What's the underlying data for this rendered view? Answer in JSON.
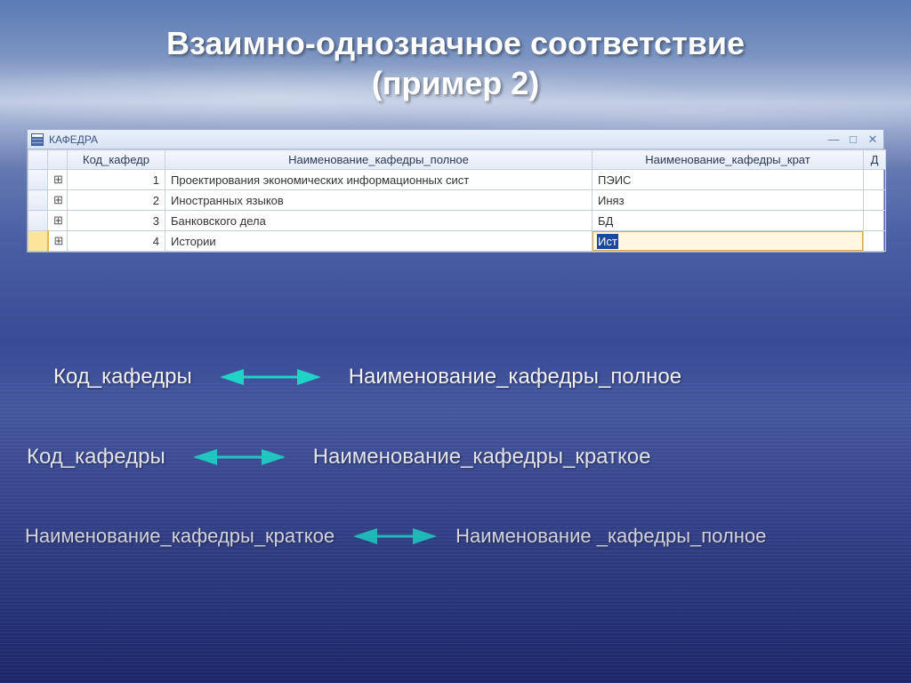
{
  "slide": {
    "title_line1": "Взаимно-однозначное  соответствие",
    "title_line2": "(пример 2)"
  },
  "dbwindow": {
    "table_name": "КАФЕДРА",
    "win_min": "—",
    "win_max": "□",
    "win_close": "✕",
    "columns": {
      "code": "Код_кафедр",
      "full": "Наименование_кафедры_полное",
      "short": "Наименование_кафедры_крат",
      "last": "Д"
    },
    "rows": [
      {
        "code": "1",
        "full": "Проектирования экономических информационных сист",
        "short": "ПЭИС"
      },
      {
        "code": "2",
        "full": "Иностранных языков",
        "short": "Иняз"
      },
      {
        "code": "3",
        "full": "Банковского дела",
        "short": "БД"
      },
      {
        "code": "4",
        "full": "Истории",
        "short_editing": "Ист"
      }
    ],
    "expand_glyph": "⊞"
  },
  "relations": {
    "r1_left": "Код_кафедры",
    "r1_right": "Наименование_кафедры_полное",
    "r2_left": "Код_кафедры",
    "r2_right": "Наименование_кафедры_краткое",
    "r3_left": "Наименование_кафедры_краткое",
    "r3_right": "Наименование _кафедры_полное"
  },
  "arrow_color": "#1fd3c7"
}
